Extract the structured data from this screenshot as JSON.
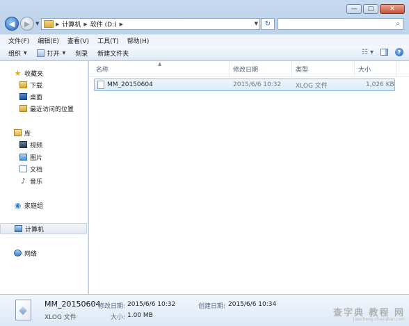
{
  "window": {
    "controls": {
      "minimize": "—",
      "maximize": "□",
      "close": "✕"
    }
  },
  "address": {
    "crumbs": [
      "计算机",
      "软件 (D:)"
    ],
    "refresh_glyph": "↻",
    "search_placeholder": ""
  },
  "menu": [
    "文件(F)",
    "编辑(E)",
    "查看(V)",
    "工具(T)",
    "帮助(H)"
  ],
  "toolbar": {
    "organize": "组织",
    "open": "打开",
    "burn": "刻录",
    "new_folder": "新建文件夹"
  },
  "nav": {
    "favorites": "收藏夹",
    "downloads": "下载",
    "desktop": "桌面",
    "recent": "最近访问的位置",
    "libraries": "库",
    "videos": "视频",
    "pictures": "图片",
    "documents": "文档",
    "music": "音乐",
    "homegroup": "家庭组",
    "computer": "计算机",
    "network": "网络"
  },
  "columns": {
    "name": "名称",
    "modified": "修改日期",
    "type": "类型",
    "size": "大小"
  },
  "files": [
    {
      "name": "MM_20150604",
      "modified": "2015/6/6 10:32",
      "type": "XLOG 文件",
      "size": "1,026 KB"
    }
  ],
  "details": {
    "name": "MM_20150604",
    "type": "XLOG 文件",
    "modified_label": "修改日期:",
    "modified_value": "2015/6/6 10:32",
    "created_label": "创建日期:",
    "created_value": "2015/6/6 10:34",
    "size_label": "大小:",
    "size_value": "1.00 MB"
  },
  "watermark": {
    "main": "查字典 教程 网",
    "sub": "jiaocheng.chazidian.com"
  }
}
